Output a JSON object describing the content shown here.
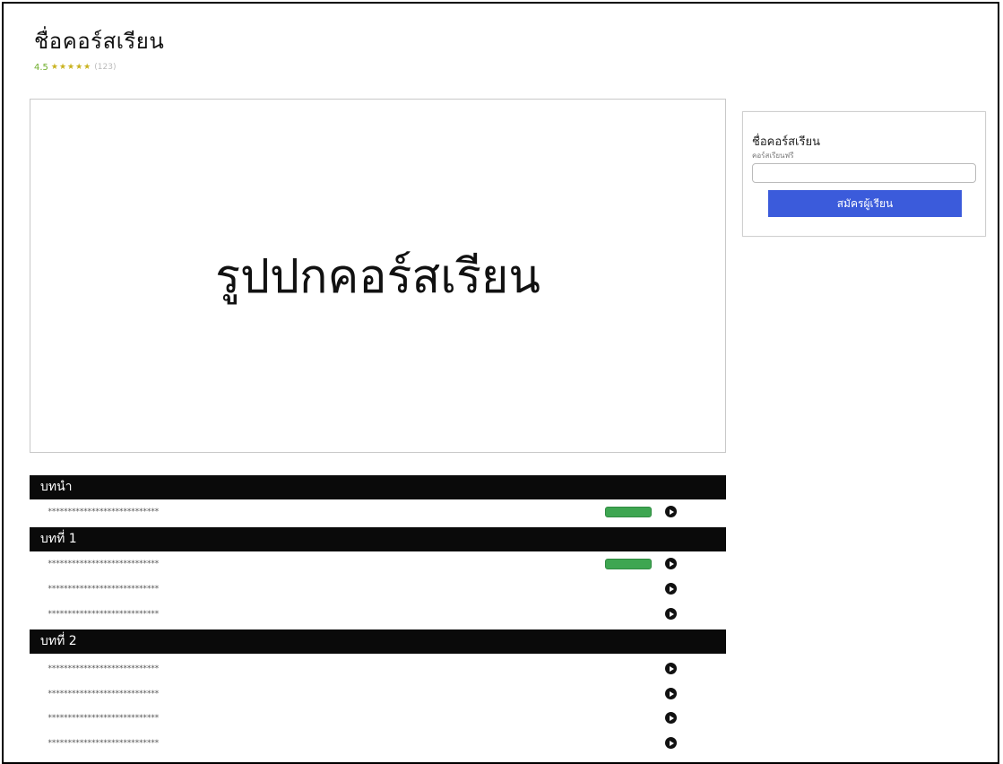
{
  "course": {
    "title": "ชื่อคอร์สเรียน",
    "rating_value": "4.5",
    "stars": "★★★★★",
    "rating_count": "(123)",
    "cover_text": "รูปปกคอร์สเรียน"
  },
  "enroll_card": {
    "title": "ชื่อคอร์สเรียน",
    "small_text": "คอร์สเรียนฟรี",
    "input_value": "",
    "button_label": "สมัครผู้เรียน"
  },
  "sections": [
    {
      "title": "บทนำ",
      "lessons": [
        {
          "text": "****************************",
          "badge": true
        }
      ]
    },
    {
      "title": "บทที่ 1",
      "lessons": [
        {
          "text": "****************************",
          "badge": true
        },
        {
          "text": "****************************",
          "badge": false
        },
        {
          "text": "****************************",
          "badge": false
        }
      ]
    },
    {
      "title": "บทที่ 2",
      "lessons": [
        {
          "text": "****************************",
          "badge": false
        },
        {
          "text": "****************************",
          "badge": false
        },
        {
          "text": "****************************",
          "badge": false
        },
        {
          "text": "****************************",
          "badge": false
        }
      ]
    }
  ],
  "colors": {
    "accent_button": "#3b5bdb",
    "section_bar": "#0a0a0a",
    "badge_green": "#3ea651",
    "rating_green": "#6fae2c"
  }
}
